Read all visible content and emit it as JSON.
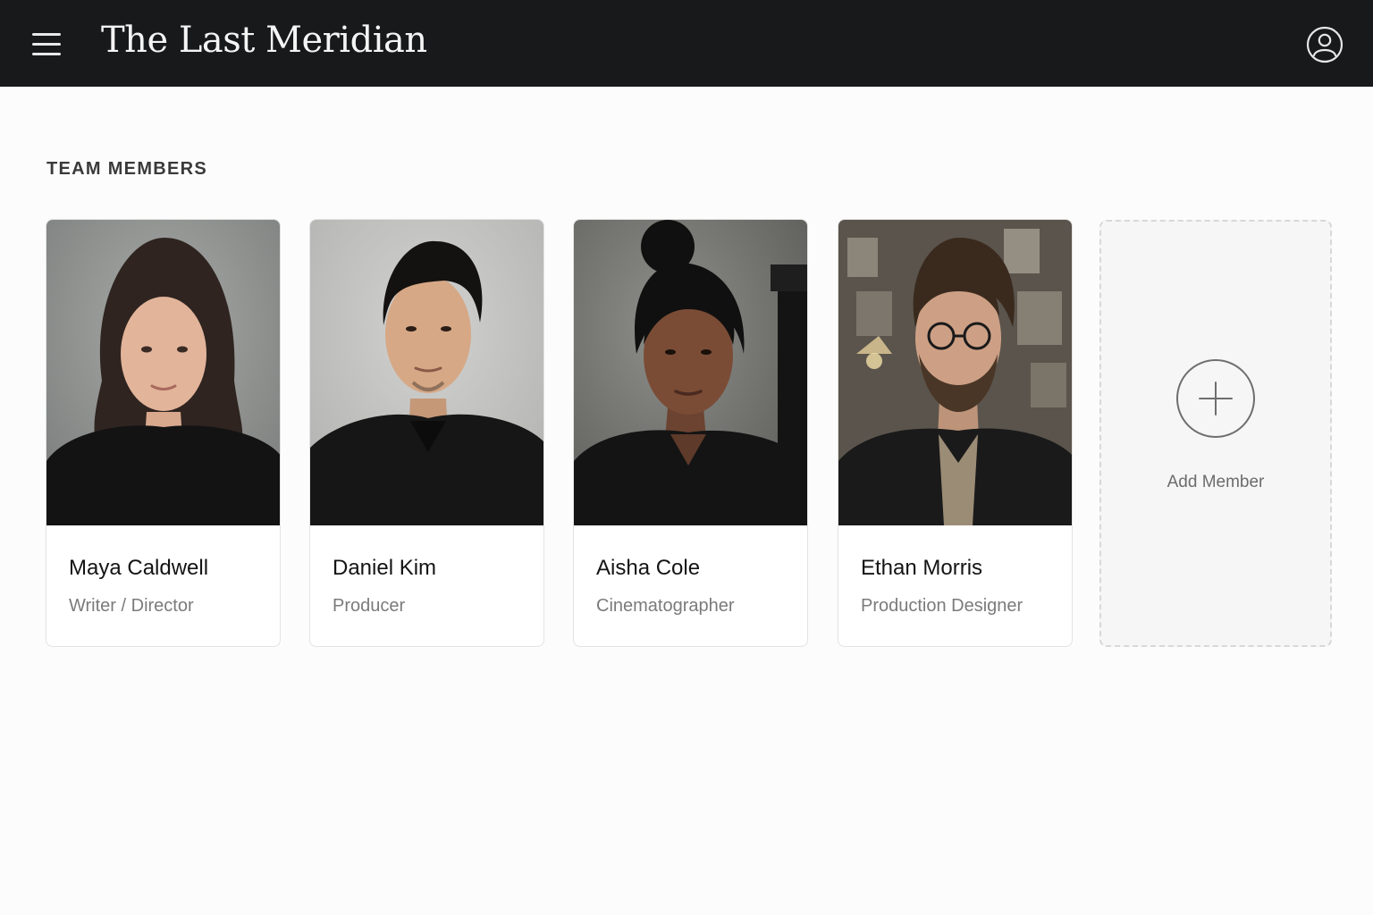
{
  "header": {
    "title": "The Last Meridian",
    "menu_icon": "hamburger-menu-icon",
    "account_icon": "user-account-icon",
    "background": "#18191b"
  },
  "section": {
    "heading": "TEAM MEMBERS"
  },
  "members": [
    {
      "name": "Maya Caldwell",
      "role": "Writer / Director"
    },
    {
      "name": "Daniel Kim",
      "role": "Producer"
    },
    {
      "name": "Aisha Cole",
      "role": "Cinematographer"
    },
    {
      "name": "Ethan Morris",
      "role": "Production Designer"
    }
  ],
  "add_card": {
    "label": "Add Member",
    "icon": "plus-icon"
  }
}
